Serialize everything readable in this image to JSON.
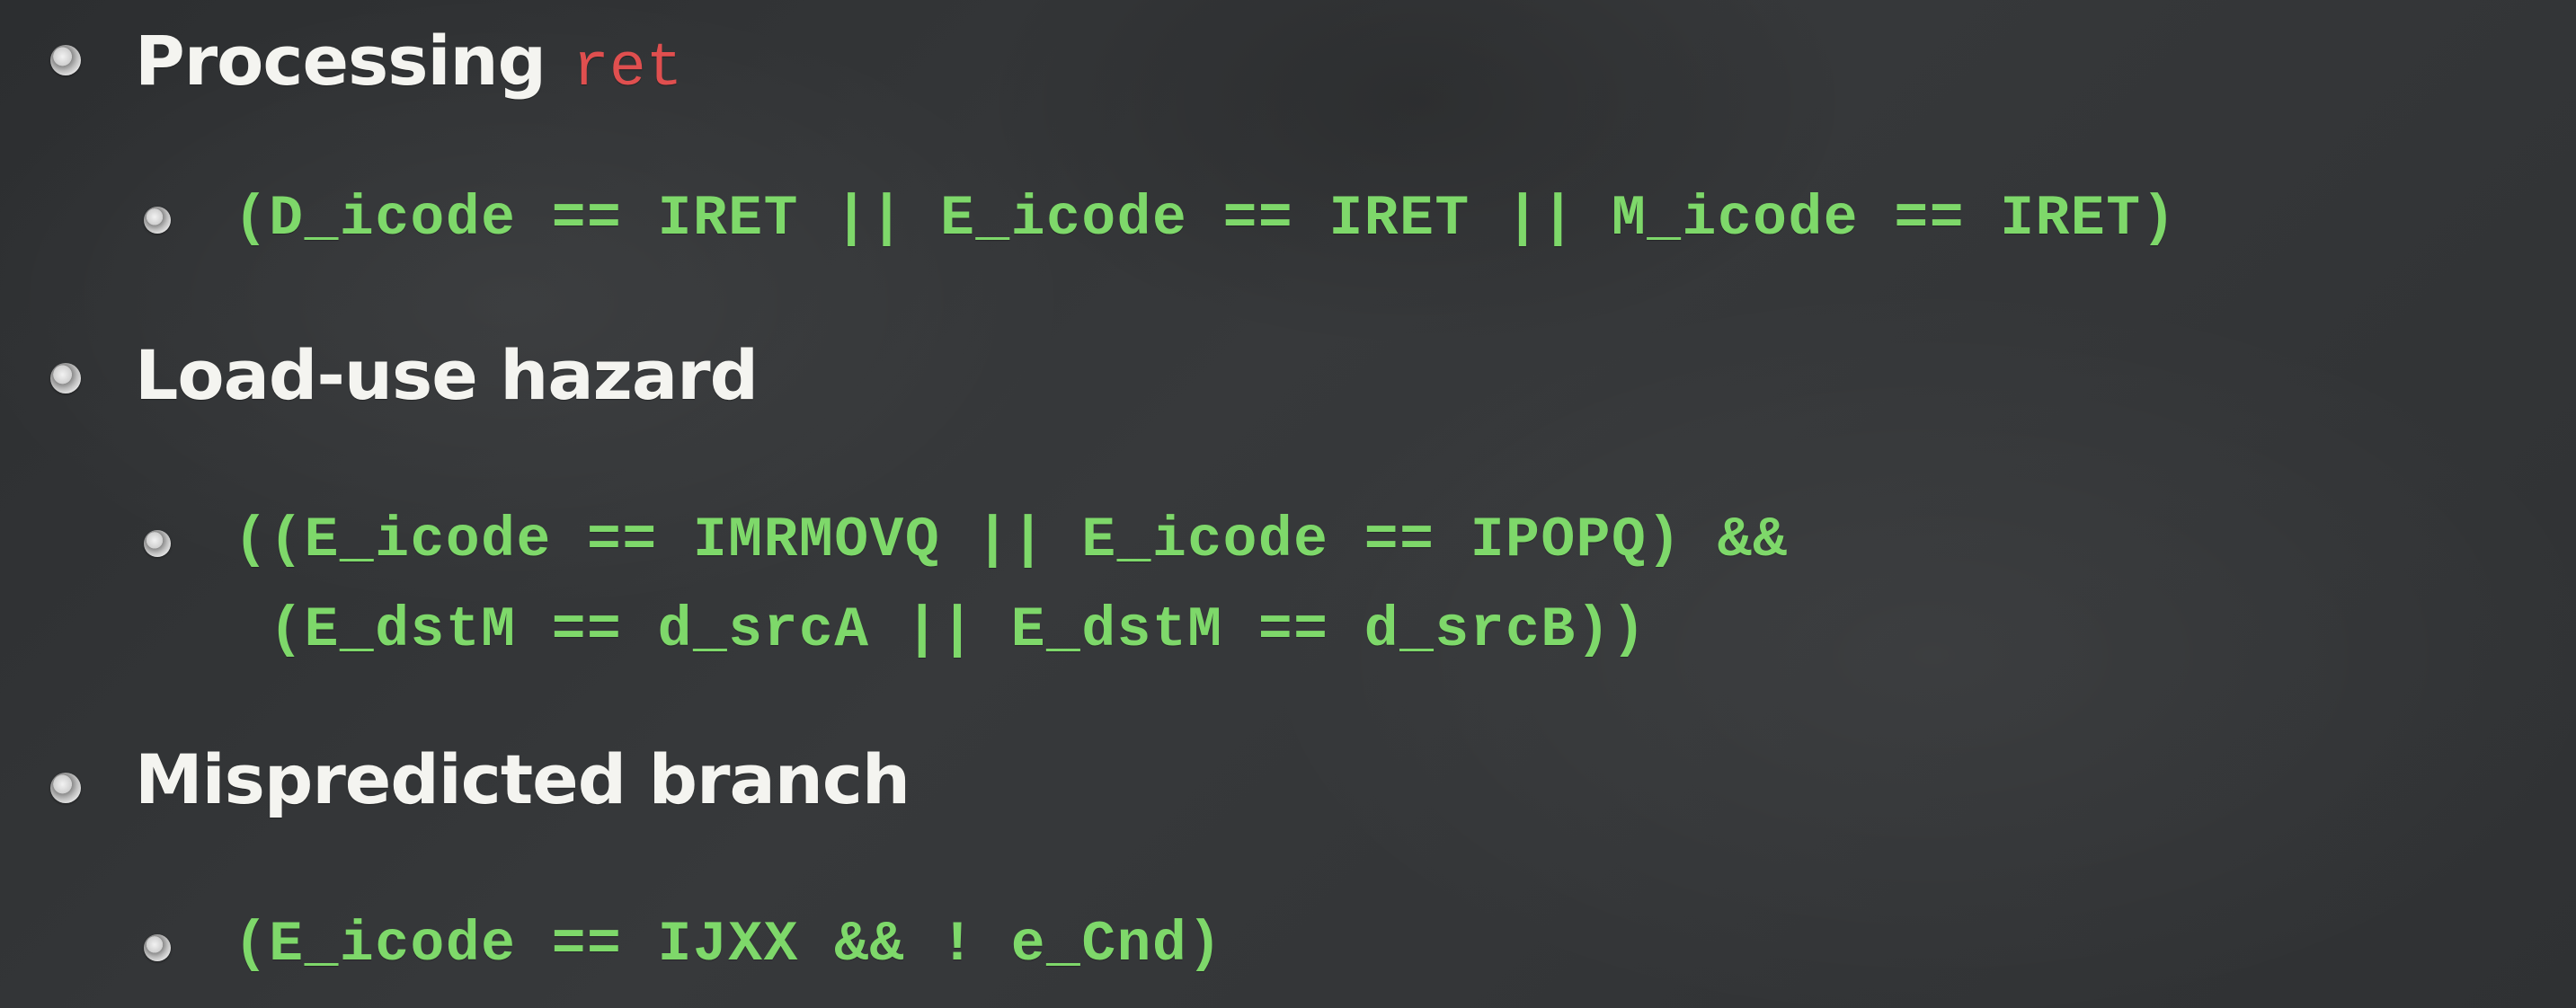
{
  "slide": {
    "items": [
      {
        "heading": "Processing",
        "heading_code": "ret",
        "code_lines": [
          "(D_icode == IRET || E_icode == IRET || M_icode == IRET)"
        ]
      },
      {
        "heading": "Load-use hazard",
        "code_lines": [
          "((E_icode == IMRMOVQ || E_icode == IPOPQ) &&",
          " (E_dstM == d_srcA || E_dstM == d_srcB))"
        ]
      },
      {
        "heading": "Mispredicted branch",
        "code_lines": [
          "(E_icode == IJXX && ! e_Cnd)"
        ]
      }
    ]
  },
  "colors": {
    "background": "#323436",
    "heading_text": "#f4f4f0",
    "code_text": "#7ed86a",
    "keyword_text": "#e04f4f"
  }
}
